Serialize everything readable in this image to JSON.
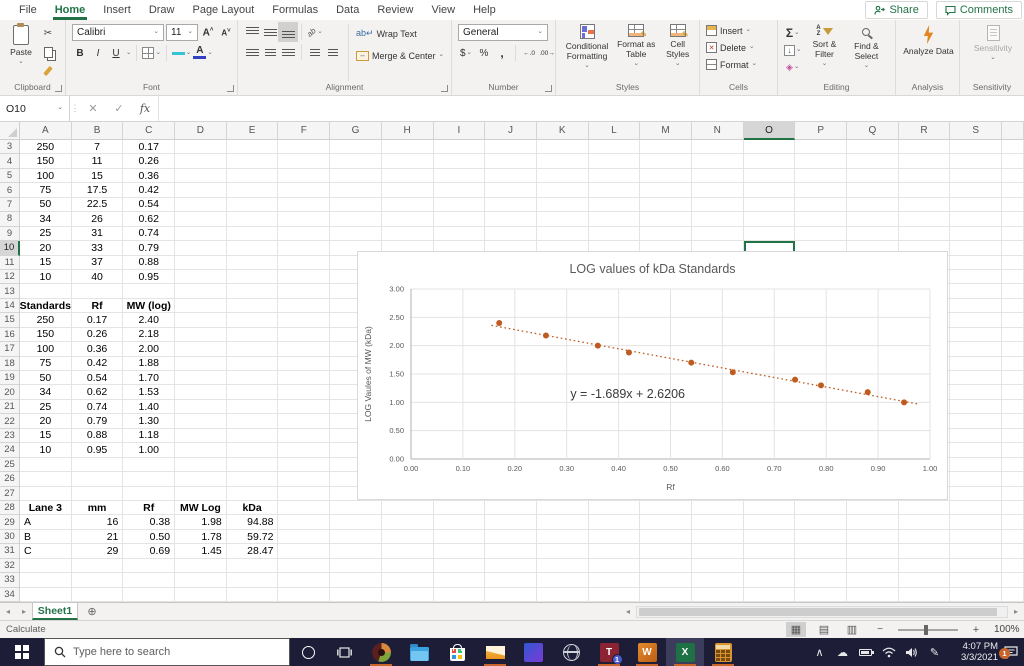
{
  "chrome": {
    "tabs": [
      "File",
      "Home",
      "Insert",
      "Draw",
      "Page Layout",
      "Formulas",
      "Data",
      "Review",
      "View",
      "Help"
    ],
    "active_tab": "Home",
    "share": "Share",
    "comments": "Comments"
  },
  "ribbon": {
    "paste_label": "Paste",
    "font_name": "Calibri",
    "font_size": "11",
    "bold": "B",
    "italic": "I",
    "underline": "U",
    "wrap_text": "Wrap Text",
    "merge_center": "Merge & Center",
    "number_format": "General",
    "currency": "$",
    "percent": "%",
    "comma": ",",
    "inc_decimal": "←.0",
    "dec_decimal": ".00→",
    "sigma": "Σ",
    "cond_fmt": "Conditional Formatting",
    "fmt_table": "Format as Table",
    "cell_styles": "Cell Styles",
    "insert": "Insert",
    "delete": "Delete",
    "format": "Format",
    "sort_filter": "Sort & Filter",
    "find_select": "Find & Select",
    "analyze_data": "Analyze Data",
    "sensitivity": "Sensitivity",
    "groups": {
      "clipboard": "Clipboard",
      "font": "Font",
      "alignment": "Alignment",
      "number": "Number",
      "styles": "Styles",
      "cells": "Cells",
      "editing": "Editing",
      "analysis": "Analysis",
      "sensitivity": "Sensitivity"
    }
  },
  "formula_bar": {
    "name_box": "O10",
    "fx_label": "fx",
    "formula": ""
  },
  "grid": {
    "columns": [
      "A",
      "B",
      "C",
      "D",
      "E",
      "F",
      "G",
      "H",
      "I",
      "J",
      "K",
      "L",
      "M",
      "N",
      "O",
      "P",
      "Q",
      "R",
      "S"
    ],
    "selected_column": "O",
    "selected_row": 10,
    "first_row": 3,
    "last_row": 34,
    "cells": [
      {
        "r": 3,
        "c": "A",
        "v": "250"
      },
      {
        "r": 3,
        "c": "B",
        "v": "7"
      },
      {
        "r": 3,
        "c": "C",
        "v": "0.17"
      },
      {
        "r": 4,
        "c": "A",
        "v": "150"
      },
      {
        "r": 4,
        "c": "B",
        "v": "11"
      },
      {
        "r": 4,
        "c": "C",
        "v": "0.26"
      },
      {
        "r": 5,
        "c": "A",
        "v": "100"
      },
      {
        "r": 5,
        "c": "B",
        "v": "15"
      },
      {
        "r": 5,
        "c": "C",
        "v": "0.36"
      },
      {
        "r": 6,
        "c": "A",
        "v": "75"
      },
      {
        "r": 6,
        "c": "B",
        "v": "17.5"
      },
      {
        "r": 6,
        "c": "C",
        "v": "0.42"
      },
      {
        "r": 7,
        "c": "A",
        "v": "50"
      },
      {
        "r": 7,
        "c": "B",
        "v": "22.5"
      },
      {
        "r": 7,
        "c": "C",
        "v": "0.54"
      },
      {
        "r": 8,
        "c": "A",
        "v": "34"
      },
      {
        "r": 8,
        "c": "B",
        "v": "26"
      },
      {
        "r": 8,
        "c": "C",
        "v": "0.62"
      },
      {
        "r": 9,
        "c": "A",
        "v": "25"
      },
      {
        "r": 9,
        "c": "B",
        "v": "31"
      },
      {
        "r": 9,
        "c": "C",
        "v": "0.74"
      },
      {
        "r": 10,
        "c": "A",
        "v": "20"
      },
      {
        "r": 10,
        "c": "B",
        "v": "33"
      },
      {
        "r": 10,
        "c": "C",
        "v": "0.79"
      },
      {
        "r": 11,
        "c": "A",
        "v": "15"
      },
      {
        "r": 11,
        "c": "B",
        "v": "37"
      },
      {
        "r": 11,
        "c": "C",
        "v": "0.88"
      },
      {
        "r": 12,
        "c": "A",
        "v": "10"
      },
      {
        "r": 12,
        "c": "B",
        "v": "40"
      },
      {
        "r": 12,
        "c": "C",
        "v": "0.95"
      },
      {
        "r": 14,
        "c": "A",
        "v": "Standards",
        "b": true
      },
      {
        "r": 14,
        "c": "B",
        "v": "Rf",
        "b": true
      },
      {
        "r": 14,
        "c": "C",
        "v": "MW (log)",
        "b": true
      },
      {
        "r": 15,
        "c": "A",
        "v": "250"
      },
      {
        "r": 15,
        "c": "B",
        "v": "0.17"
      },
      {
        "r": 15,
        "c": "C",
        "v": "2.40"
      },
      {
        "r": 16,
        "c": "A",
        "v": "150"
      },
      {
        "r": 16,
        "c": "B",
        "v": "0.26"
      },
      {
        "r": 16,
        "c": "C",
        "v": "2.18"
      },
      {
        "r": 17,
        "c": "A",
        "v": "100"
      },
      {
        "r": 17,
        "c": "B",
        "v": "0.36"
      },
      {
        "r": 17,
        "c": "C",
        "v": "2.00"
      },
      {
        "r": 18,
        "c": "A",
        "v": "75"
      },
      {
        "r": 18,
        "c": "B",
        "v": "0.42"
      },
      {
        "r": 18,
        "c": "C",
        "v": "1.88"
      },
      {
        "r": 19,
        "c": "A",
        "v": "50"
      },
      {
        "r": 19,
        "c": "B",
        "v": "0.54"
      },
      {
        "r": 19,
        "c": "C",
        "v": "1.70"
      },
      {
        "r": 20,
        "c": "A",
        "v": "34"
      },
      {
        "r": 20,
        "c": "B",
        "v": "0.62"
      },
      {
        "r": 20,
        "c": "C",
        "v": "1.53"
      },
      {
        "r": 21,
        "c": "A",
        "v": "25"
      },
      {
        "r": 21,
        "c": "B",
        "v": "0.74"
      },
      {
        "r": 21,
        "c": "C",
        "v": "1.40"
      },
      {
        "r": 22,
        "c": "A",
        "v": "20"
      },
      {
        "r": 22,
        "c": "B",
        "v": "0.79"
      },
      {
        "r": 22,
        "c": "C",
        "v": "1.30"
      },
      {
        "r": 23,
        "c": "A",
        "v": "15"
      },
      {
        "r": 23,
        "c": "B",
        "v": "0.88"
      },
      {
        "r": 23,
        "c": "C",
        "v": "1.18"
      },
      {
        "r": 24,
        "c": "A",
        "v": "10"
      },
      {
        "r": 24,
        "c": "B",
        "v": "0.95"
      },
      {
        "r": 24,
        "c": "C",
        "v": "1.00"
      },
      {
        "r": 28,
        "c": "A",
        "v": "Lane 3",
        "b": true
      },
      {
        "r": 28,
        "c": "B",
        "v": "mm",
        "b": true
      },
      {
        "r": 28,
        "c": "C",
        "v": "Rf",
        "b": true
      },
      {
        "r": 28,
        "c": "D",
        "v": "MW Log",
        "b": true
      },
      {
        "r": 28,
        "c": "E",
        "v": "kDa",
        "b": true
      },
      {
        "r": 29,
        "c": "A",
        "v": "A",
        "a": "l"
      },
      {
        "r": 29,
        "c": "B",
        "v": "16",
        "a": "r"
      },
      {
        "r": 29,
        "c": "C",
        "v": "0.38",
        "a": "r"
      },
      {
        "r": 29,
        "c": "D",
        "v": "1.98",
        "a": "r"
      },
      {
        "r": 29,
        "c": "E",
        "v": "94.88",
        "a": "r"
      },
      {
        "r": 30,
        "c": "A",
        "v": "B",
        "a": "l"
      },
      {
        "r": 30,
        "c": "B",
        "v": "21",
        "a": "r"
      },
      {
        "r": 30,
        "c": "C",
        "v": "0.50",
        "a": "r"
      },
      {
        "r": 30,
        "c": "D",
        "v": "1.78",
        "a": "r"
      },
      {
        "r": 30,
        "c": "E",
        "v": "59.72",
        "a": "r"
      },
      {
        "r": 31,
        "c": "A",
        "v": "C",
        "a": "l"
      },
      {
        "r": 31,
        "c": "B",
        "v": "29",
        "a": "r"
      },
      {
        "r": 31,
        "c": "C",
        "v": "0.69",
        "a": "r"
      },
      {
        "r": 31,
        "c": "D",
        "v": "1.45",
        "a": "r"
      },
      {
        "r": 31,
        "c": "E",
        "v": "28.47",
        "a": "r"
      }
    ]
  },
  "chart_data": {
    "type": "scatter",
    "title": "LOG values of kDa Standards",
    "xlabel": "Rf",
    "ylabel": "LOG Vaules of MW (kDa)",
    "x": [
      0.17,
      0.26,
      0.36,
      0.42,
      0.54,
      0.62,
      0.74,
      0.79,
      0.88,
      0.95
    ],
    "y": [
      2.4,
      2.18,
      2.0,
      1.88,
      1.7,
      1.53,
      1.4,
      1.3,
      1.18,
      1.0
    ],
    "xlim": [
      0,
      1
    ],
    "ylim": [
      0,
      3
    ],
    "xticks": [
      "0.00",
      "0.10",
      "0.20",
      "0.30",
      "0.40",
      "0.50",
      "0.60",
      "0.70",
      "0.80",
      "0.90",
      "1.00"
    ],
    "yticks": [
      "0.00",
      "0.50",
      "1.00",
      "1.50",
      "2.00",
      "2.50",
      "3.00"
    ],
    "grid": true,
    "point_color": "#BE5B21",
    "trendline": {
      "equation": "y = -1.689x + 2.6206",
      "slope": -1.689,
      "intercept": 2.6206,
      "x_start": 0.155,
      "x_end": 0.975,
      "style": "dotted"
    },
    "equation_pos": {
      "x": 0.307,
      "y": 1.08
    }
  },
  "sheet_bar": {
    "active_sheet": "Sheet1"
  },
  "status_bar": {
    "mode": "Calculate",
    "zoom_percent": "100%"
  },
  "taskbar": {
    "search_placeholder": "Type here to search",
    "time": "4:07 PM",
    "date": "3/3/2021",
    "teams_badge": "1",
    "action_badge": "1"
  }
}
